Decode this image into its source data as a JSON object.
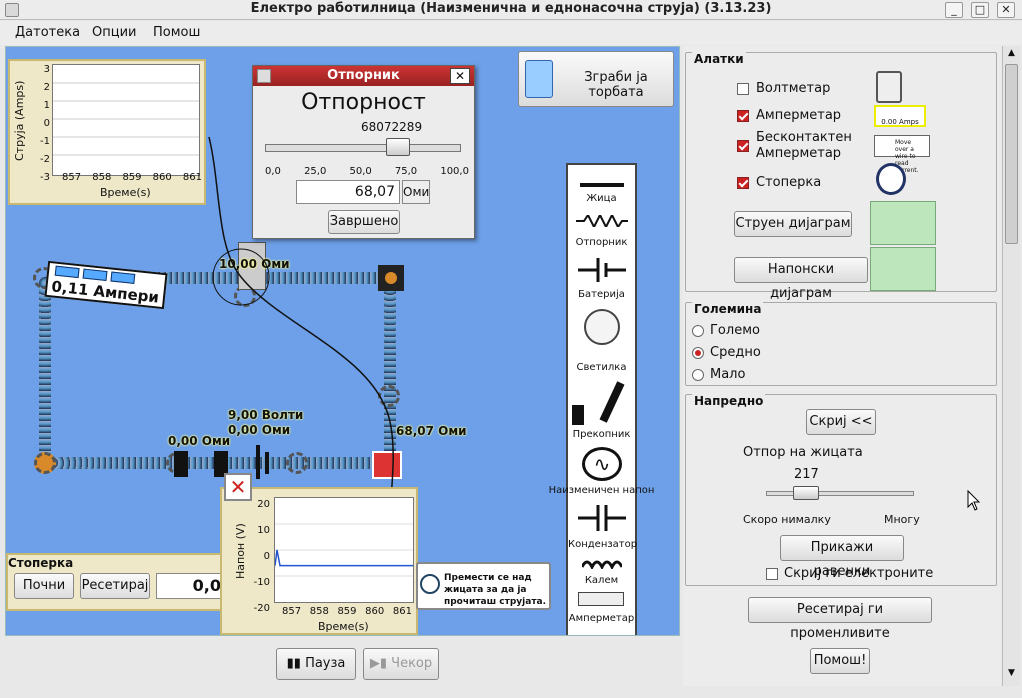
{
  "window": {
    "title": "Електро работилница (Наизменична и еднонасочна струја) (3.13.23)"
  },
  "menu": {
    "file": "Датотека",
    "options": "Опции",
    "help": "Помош"
  },
  "current_chart": {
    "ylabel": "Струја (Amps)",
    "xlabel": "Време(s)",
    "yticks": [
      "3",
      "2",
      "1",
      "0",
      "-1",
      "-2",
      "-3"
    ],
    "xticks": [
      "857",
      "858",
      "859",
      "860",
      "861"
    ]
  },
  "voltage_chart": {
    "ylabel": "Напон (V)",
    "xlabel": "Време(s)",
    "yticks": [
      "20",
      "10",
      "0",
      "-10",
      "-20"
    ],
    "xticks": [
      "857",
      "858",
      "859",
      "860",
      "861"
    ],
    "value": -6
  },
  "grab_bag": {
    "label": "Зграби ја торбата"
  },
  "resistor_dialog": {
    "title": "Отпорник",
    "heading": "Отпорност",
    "sub_value": "68072289",
    "slider_ticks": [
      "0,0",
      "25,0",
      "50,0",
      "75,0",
      "100,0"
    ],
    "slider_value": 68.07,
    "value": "68,07",
    "unit": "Оми",
    "done": "Завршено"
  },
  "circuit": {
    "ammeter_reading": "0,11 Ампери",
    "label_top": "10,00 Оми",
    "label_battery_v": "9,00 Волти",
    "label_battery_r": "0,00 Оми",
    "label_left": "0,00 Оми",
    "label_right": "68,07 Оми"
  },
  "toolbox": {
    "items": [
      "Жица",
      "Отпорник",
      "Батерија",
      "Светилка",
      "Прекопник",
      "Наизменичен напон",
      "Кондензатор",
      "Калем",
      "Амперметар"
    ]
  },
  "stopwatch": {
    "title": "Стоперка",
    "start": "Почни",
    "reset": "Ресетирај",
    "value": "0,0"
  },
  "noncontact_hint": {
    "text": "Премести се над жицата за да ја прочиташ струјата."
  },
  "playback": {
    "pause": "Пауза",
    "step": "Чекор"
  },
  "tools": {
    "legend": "Алатки",
    "voltmeter": "Волтметар",
    "ammeter": "Амперметар",
    "noncontact": "Бесконтактен Амперметар",
    "stopwatch": "Стоперка",
    "current_chart_btn": "Струен дијаграм",
    "voltage_chart_btn": "Напонски дијаграм",
    "ammeter_display": "0.00 Amps",
    "noncontact_display": "Move over a wire to read current."
  },
  "size": {
    "legend": "Големина",
    "large": "Големо",
    "medium": "Средно",
    "small": "Мало",
    "selected": "Средно"
  },
  "advanced": {
    "legend": "Напредно",
    "hide": "Скриј <<",
    "wire_resistance_label": "Отпор на жицата",
    "wire_resistance_value": "217",
    "slider_fraction": 0.27,
    "min_label": "Скоро нималку",
    "max_label": "Многу",
    "show_equations": "Прикажи равенки",
    "hide_electrons": "Скриј ги електроните"
  },
  "reset_all": "Ресетирај ги променливите",
  "help_button": "Помош!",
  "colors": {
    "canvas": "#6da0e8",
    "accent_red": "#cc2222",
    "chart_panel": "#efe8c8"
  }
}
